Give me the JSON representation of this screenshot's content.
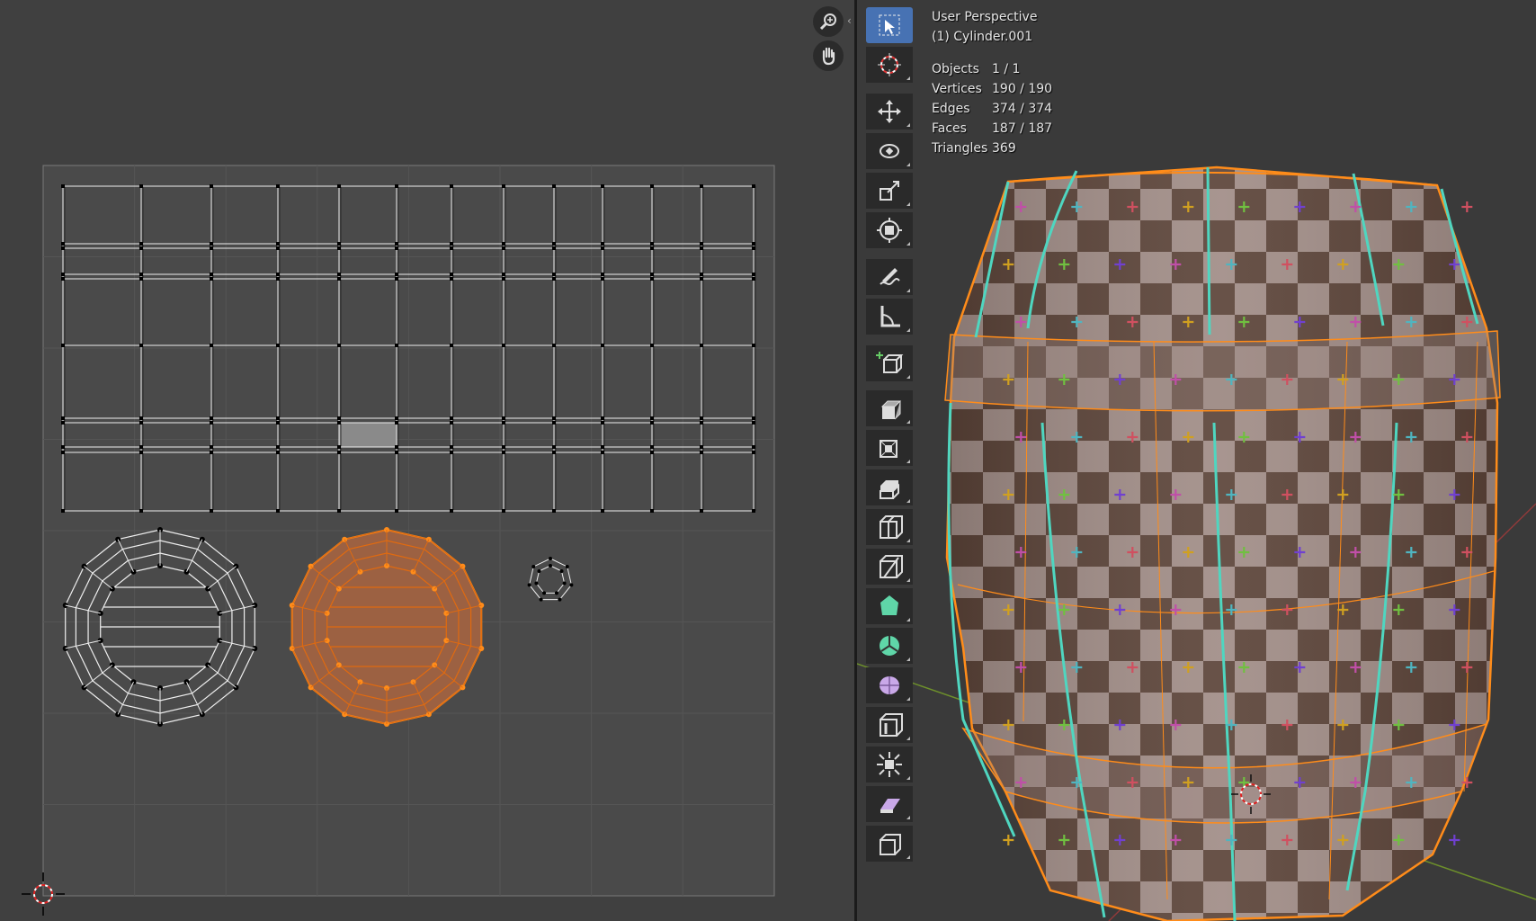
{
  "viewport": {
    "view_name": "User Perspective",
    "object_name": "(1) Cylinder.001",
    "stats": [
      {
        "label": "Objects",
        "value": "1 / 1"
      },
      {
        "label": "Vertices",
        "value": "190 / 190"
      },
      {
        "label": "Edges",
        "value": "374 / 374"
      },
      {
        "label": "Faces",
        "value": "187 / 187"
      },
      {
        "label": "Triangles",
        "value": "369"
      }
    ]
  },
  "toolbar": {
    "tools": [
      {
        "name": "select-box",
        "icon": "select-box-icon",
        "active": true
      },
      {
        "name": "cursor",
        "icon": "cursor-icon"
      },
      {
        "name": "move",
        "icon": "move-icon"
      },
      {
        "name": "rotate",
        "icon": "rotate-icon"
      },
      {
        "name": "scale",
        "icon": "scale-icon"
      },
      {
        "name": "transform",
        "icon": "transform-icon"
      },
      {
        "name": "annotate",
        "icon": "annotate-icon"
      },
      {
        "name": "measure",
        "icon": "measure-icon"
      },
      {
        "name": "add-cube",
        "icon": "add-cube-icon"
      },
      {
        "name": "extrude",
        "icon": "extrude-icon"
      },
      {
        "name": "inset",
        "icon": "inset-icon"
      },
      {
        "name": "bevel",
        "icon": "bevel-icon"
      },
      {
        "name": "loop-cut",
        "icon": "loop-cut-icon"
      },
      {
        "name": "knife",
        "icon": "knife-icon"
      },
      {
        "name": "poly-build",
        "icon": "poly-build-icon"
      },
      {
        "name": "spin",
        "icon": "spin-icon"
      },
      {
        "name": "smooth",
        "icon": "smooth-icon"
      },
      {
        "name": "edge-slide",
        "icon": "edge-slide-icon"
      },
      {
        "name": "shrink-fatten",
        "icon": "shrink-fatten-icon"
      },
      {
        "name": "shear",
        "icon": "shear-icon"
      },
      {
        "name": "rip-region",
        "icon": "rip-region-icon"
      }
    ]
  },
  "uv_editor": {
    "nav": [
      {
        "icon": "zoom-icon"
      },
      {
        "icon": "hand-pan-icon"
      }
    ]
  },
  "colors": {
    "selection": "#ff8c1a",
    "seam": "#4fd6c0",
    "active_tool": "#4772b3"
  }
}
